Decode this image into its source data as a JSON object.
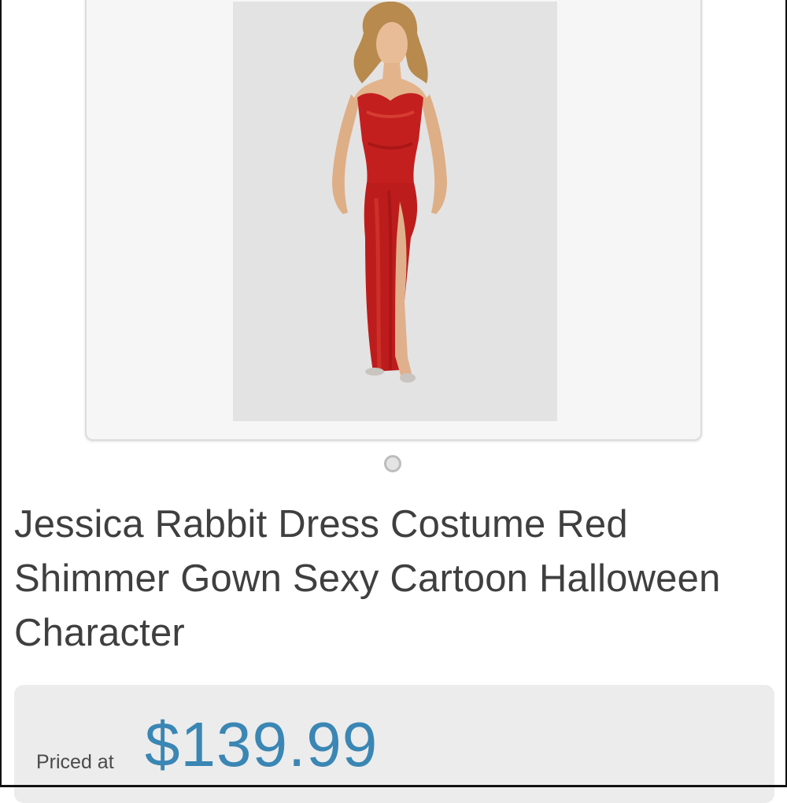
{
  "listing": {
    "title": "Jessica Rabbit Dress Costume Red Shimmer Gown Sexy Cartoon Halloween Character",
    "photo_icon": "product-photo-red-gown",
    "carousel": {
      "current_index": 1,
      "total": 1
    },
    "price": {
      "label": "Priced at",
      "value": "$139.99"
    }
  },
  "colors": {
    "price": "#3a86b4",
    "title_text": "#3f3f3f",
    "gown": "#c01f1f",
    "photo_background": "#e3e3e3"
  }
}
